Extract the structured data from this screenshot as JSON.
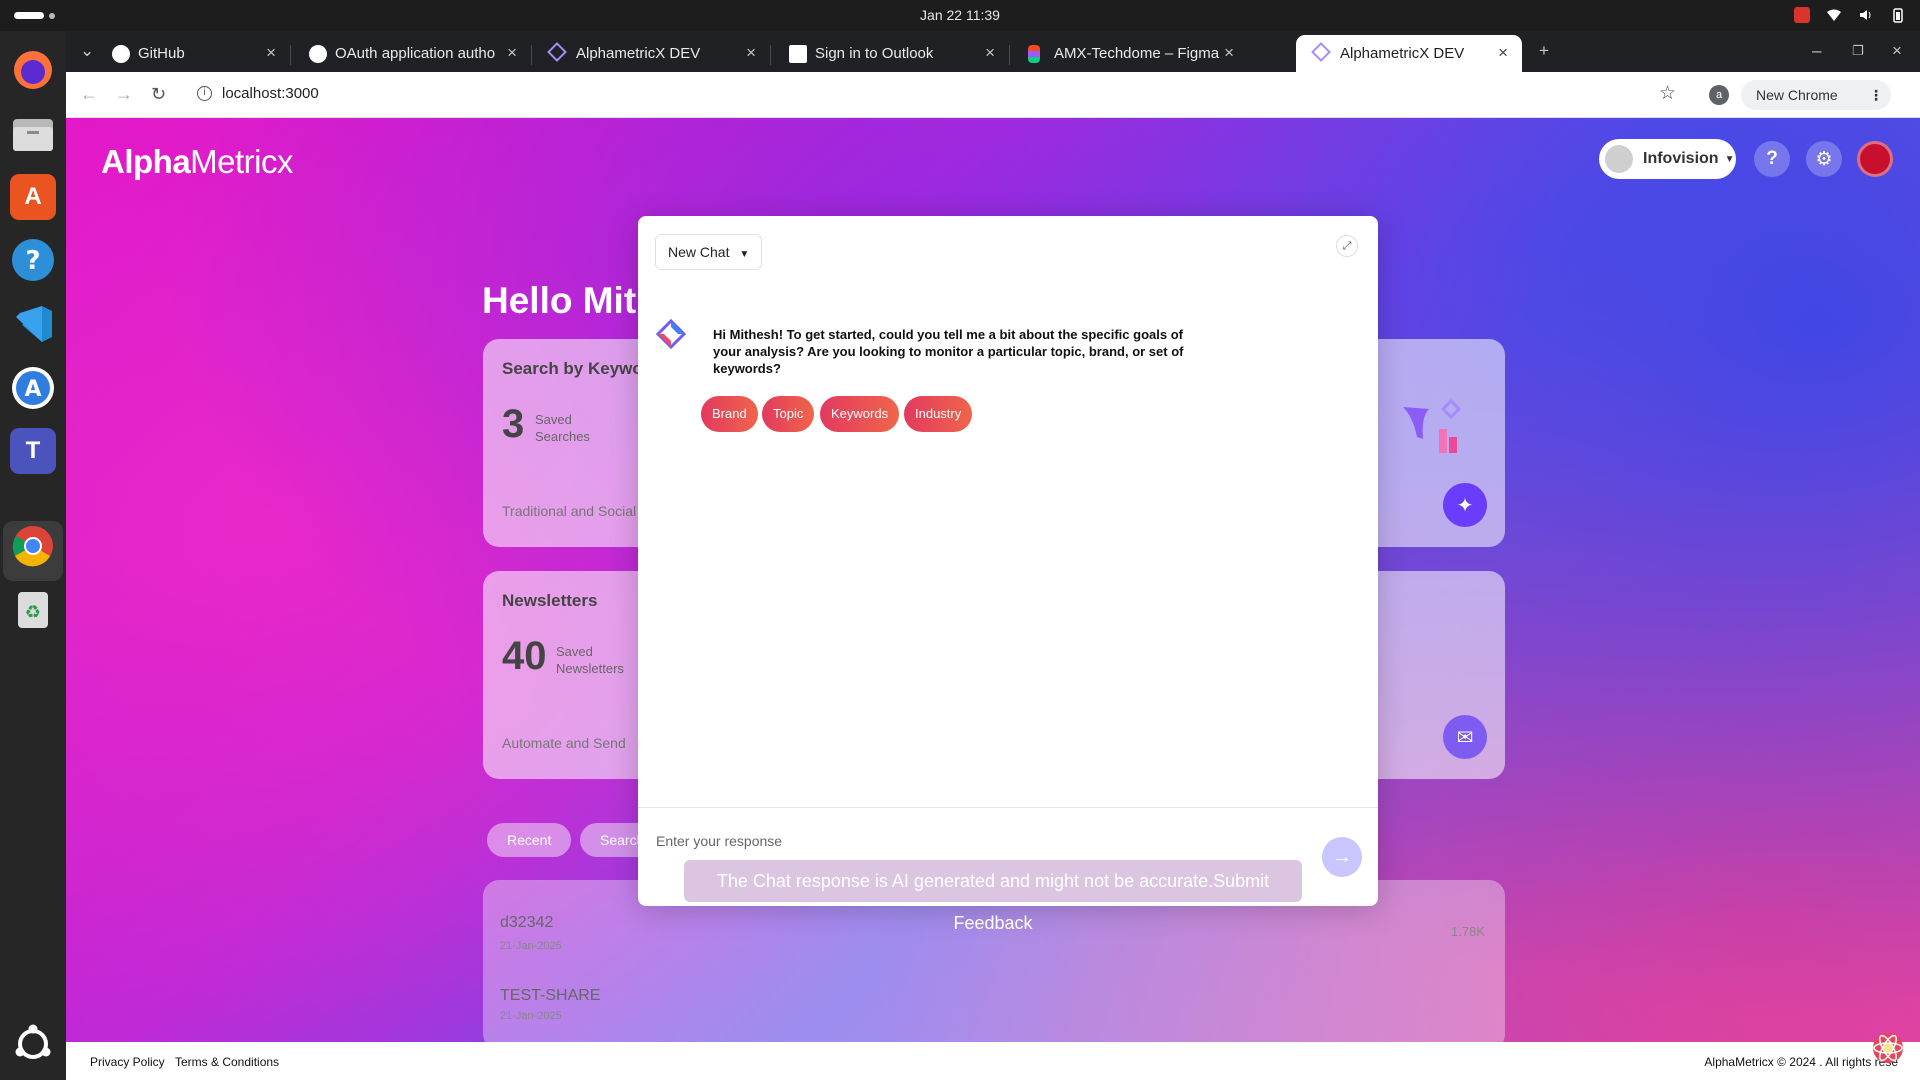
{
  "system": {
    "clock": "Jan 22  11:39"
  },
  "dock": [
    "firefox-icon",
    "files-icon",
    "app-center-icon",
    "help-icon",
    "vscode-icon",
    "app-store-icon",
    "teams-icon",
    "chrome-icon",
    "trash-icon",
    "ubuntu-icon"
  ],
  "browser": {
    "tabs": [
      {
        "label": "GitHub",
        "icon": "github-icon"
      },
      {
        "label": "OAuth application autho",
        "icon": "github-icon"
      },
      {
        "label": "AlphametricX DEV",
        "icon": "alphametricx-icon"
      },
      {
        "label": "Sign in to Outlook",
        "icon": "outlook-icon"
      },
      {
        "label": "AMX-Techdome – Figma",
        "icon": "figma-icon"
      },
      {
        "label": "AlphametricX DEV",
        "icon": "alphametricx-icon",
        "active": true
      }
    ],
    "url": "localhost:3000",
    "profile_initial": "a",
    "new_chrome_label": "New Chrome available"
  },
  "app": {
    "logo_bold": "Alpha",
    "logo_regular": "Metricx",
    "org_name": "Infovision",
    "greeting": "Hello Mith",
    "search_card": {
      "title": "Search by Keywor",
      "count": "3",
      "count_label_1": "Saved",
      "count_label_2": "Searches",
      "subtitle": "Traditional and Social"
    },
    "newsletter_card": {
      "title": "Newsletters",
      "count": "40",
      "count_label_1": "Saved",
      "count_label_2": "Newsletters",
      "subtitle": "Automate and Send"
    },
    "tabs": {
      "recent": "Recent",
      "searches": "Search"
    },
    "recent_items": [
      {
        "title": "d32342",
        "date": "21-Jan-2025",
        "value": "1.78K"
      },
      {
        "title": "TEST-SHARE",
        "date": "21-Jan-2025"
      }
    ]
  },
  "chat": {
    "dropdown_label": "New Chat",
    "message": "Hi Mithesh! To get started, could you tell me a bit about the specific goals of your analysis? Are you looking to monitor a particular topic, brand, or set of keywords?",
    "options": [
      "Brand",
      "Topic",
      "Keywords",
      "Industry"
    ],
    "input_placeholder": "Enter your response"
  },
  "disclaimer": "The Chat response is AI generated and might not be accurate.Submit Feedback",
  "footer": {
    "privacy": "Privacy Policy",
    "terms": "Terms & Conditions",
    "copyright": "AlphaMetricx © 2024 . All rights rese"
  }
}
